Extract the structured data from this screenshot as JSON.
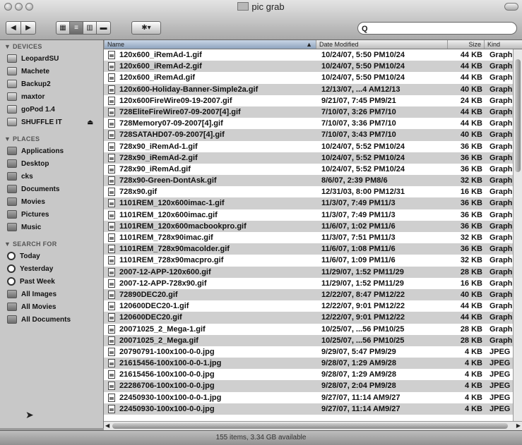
{
  "window": {
    "title": "pic grab"
  },
  "toolbar": {
    "back_label": "◀",
    "forward_label": "▶",
    "view_icon_label": "▦",
    "view_list_label": "≡",
    "view_column_label": "▥",
    "view_coverflow_label": "▬",
    "action_label": "✱▾",
    "search_glyph": "Q",
    "search_value": ""
  },
  "sidebar": {
    "devices_header": "▼ DEVICES",
    "devices": [
      "LeopardSU",
      "Machete",
      "Backup2",
      "maxtor",
      "goPod 1.4",
      "SHUFFLE IT"
    ],
    "eject_glyph": "⏏",
    "places_header": "▼ PLACES",
    "places": [
      "Applications",
      "Desktop",
      "cks",
      "Documents",
      "Movies",
      "Pictures",
      "Music"
    ],
    "search_header": "▼ SEARCH FOR",
    "searches": [
      "Today",
      "Yesterday",
      "Past Week",
      "All Images",
      "All Movies",
      "All Documents"
    ]
  },
  "columns": {
    "name": "Name",
    "sort_glyph": "▲",
    "date": "Date Modified",
    "size": "Size",
    "kind": "Kind"
  },
  "files": [
    {
      "name": "120x600_iRemAd-1.gif",
      "date": "10/24/07, 5:50 PM10/24",
      "size": "44 KB",
      "kind": "Graph..."
    },
    {
      "name": "120x600_iRemAd-2.gif",
      "date": "10/24/07, 5:50 PM10/24",
      "size": "44 KB",
      "kind": "Graph..."
    },
    {
      "name": "120x600_iRemAd.gif",
      "date": "10/24/07, 5:50 PM10/24",
      "size": "44 KB",
      "kind": "Graph..."
    },
    {
      "name": "120x600-Holiday-Banner-Simple2a.gif",
      "date": "12/13/07, ...4 AM12/13",
      "size": "40 KB",
      "kind": "Graph..."
    },
    {
      "name": "120x600FireWire09-19-2007.gif",
      "date": "9/21/07, 7:45 PM9/21",
      "size": "24 KB",
      "kind": "Graph..."
    },
    {
      "name": "728EliteFireWire07-09-2007[4].gif",
      "date": "7/10/07, 3:26 PM7/10",
      "size": "44 KB",
      "kind": "Graph..."
    },
    {
      "name": "728Memory07-09-2007[4].gif",
      "date": "7/10/07, 3:36 PM7/10",
      "size": "44 KB",
      "kind": "Graph..."
    },
    {
      "name": "728SATAHD07-09-2007[4].gif",
      "date": "7/10/07, 3:43 PM7/10",
      "size": "40 KB",
      "kind": "Graph..."
    },
    {
      "name": "728x90_iRemAd-1.gif",
      "date": "10/24/07, 5:52 PM10/24",
      "size": "36 KB",
      "kind": "Graph..."
    },
    {
      "name": "728x90_iRemAd-2.gif",
      "date": "10/24/07, 5:52 PM10/24",
      "size": "36 KB",
      "kind": "Graph..."
    },
    {
      "name": "728x90_iRemAd.gif",
      "date": "10/24/07, 5:52 PM10/24",
      "size": "36 KB",
      "kind": "Graph..."
    },
    {
      "name": "728x90-Green-DontAsk.gif",
      "date": "8/6/07, 2:39 PM8/6",
      "size": "32 KB",
      "kind": "Graph..."
    },
    {
      "name": "728x90.gif",
      "date": "12/31/03, 8:00 PM12/31",
      "size": "16 KB",
      "kind": "Graph..."
    },
    {
      "name": "1101REM_120x600imac-1.gif",
      "date": "11/3/07, 7:49 PM11/3",
      "size": "36 KB",
      "kind": "Graph..."
    },
    {
      "name": "1101REM_120x600imac.gif",
      "date": "11/3/07, 7:49 PM11/3",
      "size": "36 KB",
      "kind": "Graph..."
    },
    {
      "name": "1101REM_120x600macbookpro.gif",
      "date": "11/6/07, 1:02 PM11/6",
      "size": "36 KB",
      "kind": "Graph..."
    },
    {
      "name": "1101REM_728x90imac.gif",
      "date": "11/3/07, 7:51 PM11/3",
      "size": "32 KB",
      "kind": "Graph..."
    },
    {
      "name": "1101REM_728x90macolder.gif",
      "date": "11/6/07, 1:08 PM11/6",
      "size": "36 KB",
      "kind": "Graph..."
    },
    {
      "name": "1101REM_728x90macpro.gif",
      "date": "11/6/07, 1:09 PM11/6",
      "size": "32 KB",
      "kind": "Graph..."
    },
    {
      "name": "2007-12-APP-120x600.gif",
      "date": "11/29/07, 1:52 PM11/29",
      "size": "28 KB",
      "kind": "Graph..."
    },
    {
      "name": "2007-12-APP-728x90.gif",
      "date": "11/29/07, 1:52 PM11/29",
      "size": "16 KB",
      "kind": "Graph..."
    },
    {
      "name": "72890DEC20.gif",
      "date": "12/22/07, 8:47 PM12/22",
      "size": "40 KB",
      "kind": "Graph..."
    },
    {
      "name": "120600DEC20-1.gif",
      "date": "12/22/07, 9:01 PM12/22",
      "size": "44 KB",
      "kind": "Graph..."
    },
    {
      "name": "120600DEC20.gif",
      "date": "12/22/07, 9:01 PM12/22",
      "size": "44 KB",
      "kind": "Graph..."
    },
    {
      "name": "20071025_2_Mega-1.gif",
      "date": "10/25/07, ...56 PM10/25",
      "size": "28 KB",
      "kind": "Graph..."
    },
    {
      "name": "20071025_2_Mega.gif",
      "date": "10/25/07, ...56 PM10/25",
      "size": "28 KB",
      "kind": "Graph..."
    },
    {
      "name": "20790791-100x100-0-0.jpg",
      "date": "9/29/07, 5:47 PM9/29",
      "size": "4 KB",
      "kind": "JPEG im"
    },
    {
      "name": "21615456-100x100-0-0-1.jpg",
      "date": "9/28/07, 1:29 AM9/28",
      "size": "4 KB",
      "kind": "JPEG im"
    },
    {
      "name": "21615456-100x100-0-0.jpg",
      "date": "9/28/07, 1:29 AM9/28",
      "size": "4 KB",
      "kind": "JPEG im"
    },
    {
      "name": "22286706-100x100-0-0.jpg",
      "date": "9/28/07, 2:04 PM9/28",
      "size": "4 KB",
      "kind": "JPEG im"
    },
    {
      "name": "22450930-100x100-0-0-1.jpg",
      "date": "9/27/07, 11:14 AM9/27",
      "size": "4 KB",
      "kind": "JPEG im"
    },
    {
      "name": "22450930-100x100-0-0.jpg",
      "date": "9/27/07, 11:14 AM9/27",
      "size": "4 KB",
      "kind": "JPEG im"
    }
  ],
  "status": {
    "text": "155 items, 3.34 GB available"
  }
}
